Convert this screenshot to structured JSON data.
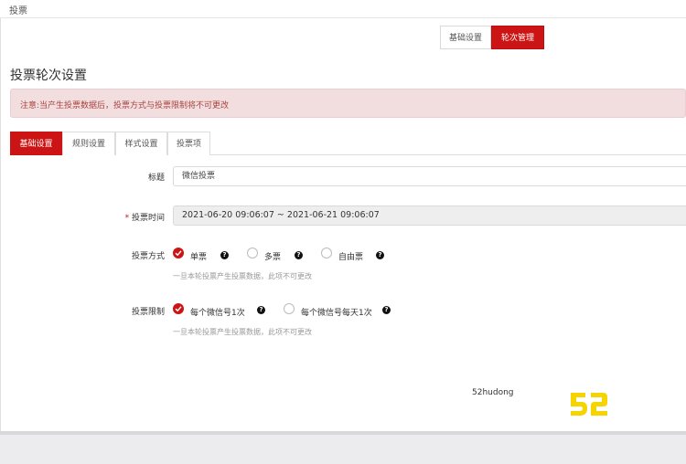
{
  "window": {
    "title": "投票"
  },
  "mode_buttons": {
    "basic": "基础设置",
    "round": "轮次管理"
  },
  "page": {
    "title": "投票轮次设置"
  },
  "alert": {
    "text": "注意:当产生投票数据后，投票方式与投票限制将不可更改"
  },
  "tabs": [
    {
      "label": "基础设置",
      "active": true
    },
    {
      "label": "规则设置",
      "active": false
    },
    {
      "label": "样式设置",
      "active": false
    },
    {
      "label": "投票项",
      "active": false
    }
  ],
  "form": {
    "title": {
      "label": "标题",
      "value": "微信投票"
    },
    "time": {
      "required_mark": "*",
      "label": "投票时间",
      "value": "2021-06-20 09:06:07 ~ 2021-06-21 09:06:07"
    },
    "method": {
      "label": "投票方式",
      "options": [
        {
          "label": "单票",
          "checked": true
        },
        {
          "label": "多票",
          "checked": false
        },
        {
          "label": "自由票",
          "checked": false
        }
      ],
      "hint": "一旦本轮投票产生投票数据，此项不可更改"
    },
    "limit": {
      "label": "投票限制",
      "options": [
        {
          "label": "每个微信号1次",
          "checked": true
        },
        {
          "label": "每个微信号每天1次",
          "checked": false
        }
      ],
      "hint": "一旦本轮投票产生投票数据，此项不可更改"
    }
  },
  "footer": {
    "text": "52hudong"
  },
  "watermark": {
    "text": "52"
  },
  "colors": {
    "accent": "#cc1414",
    "watermark": "#f5d400",
    "alert_bg": "#f2dede",
    "alert_text": "#a94442"
  },
  "icons": {
    "check": "check-circle-icon",
    "help": "question-circle-icon",
    "radio": "radio-empty-icon"
  }
}
